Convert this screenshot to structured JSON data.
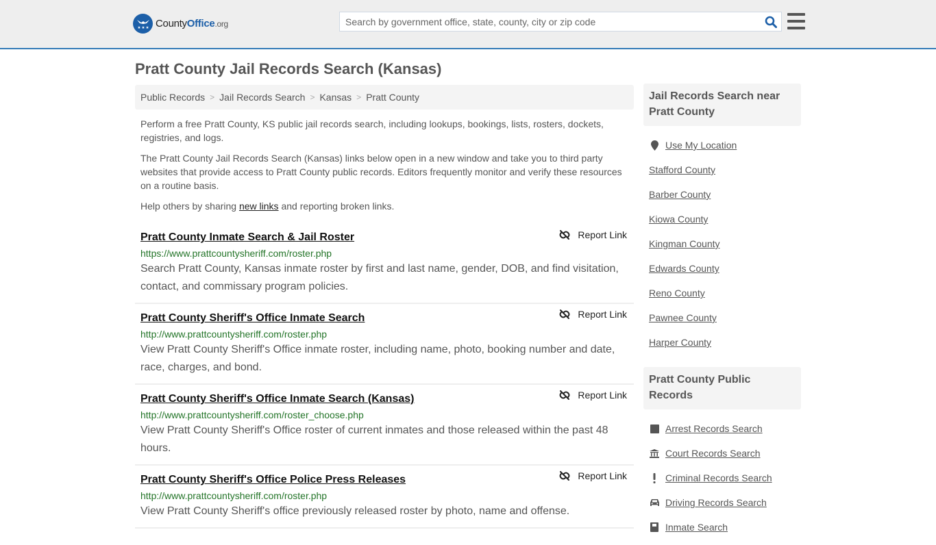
{
  "header": {
    "logo": {
      "county": "County",
      "office": "Office",
      "org": ".org"
    },
    "search_placeholder": "Search by government office, state, county, city or zip code",
    "search_value": "",
    "search_icon": "magnifier-icon",
    "menu_icon": "hamburger-icon"
  },
  "colors": {
    "header_bg": "#eeeeee",
    "header_border": "#337ab7",
    "brand_blue": "#1c5fa8",
    "url_green": "#237428",
    "text": "#555555"
  },
  "page_title": "Pratt County Jail Records Search (Kansas)",
  "breadcrumb": [
    {
      "label": "Public Records"
    },
    {
      "label": "Jail Records Search"
    },
    {
      "label": "Kansas"
    },
    {
      "label": "Pratt County"
    }
  ],
  "breadcrumb_separator": ">",
  "intro": {
    "p1": "Perform a free Pratt County, KS public jail records search, including lookups, bookings, lists, rosters, dockets, registries, and logs.",
    "p2": "The Pratt County Jail Records Search (Kansas) links below open in a new window and take you to third party websites that provide access to Pratt County public records. Editors frequently monitor and verify these resources on a routine basis.",
    "p3_before": "Help others by sharing ",
    "p3_link": "new links",
    "p3_after": " and reporting broken links."
  },
  "results": [
    {
      "title": "Pratt County Inmate Search & Jail Roster",
      "url": "https://www.prattcountysheriff.com/roster.php",
      "description": "Search Pratt County, Kansas inmate roster by first and last name, gender, DOB, and find visitation, contact, and commissary program policies.",
      "report_label": "Report Link"
    },
    {
      "title": "Pratt County Sheriff's Office Inmate Search",
      "url": "http://www.prattcountysheriff.com/roster.php",
      "description": "View Pratt County Sheriff's Office inmate roster, including name, photo, booking number and date, race, charges, and bond.",
      "report_label": "Report Link"
    },
    {
      "title": "Pratt County Sheriff's Office Inmate Search (Kansas)",
      "url": "http://www.prattcountysheriff.com/roster_choose.php",
      "description": "View Pratt County Sheriff's Office roster of current inmates and those released within the past 48 hours.",
      "report_label": "Report Link"
    },
    {
      "title": "Pratt County Sheriff's Office Police Press Releases",
      "url": "http://www.prattcountysheriff.com/roster.php",
      "description": "View Pratt County Sheriff's office previously released roster by photo, name and offense.",
      "report_label": "Report Link"
    }
  ],
  "sidebar": {
    "nearby": {
      "heading": "Jail Records Search near Pratt County",
      "use_location": {
        "label": "Use My Location",
        "icon": "map-marker-icon"
      },
      "items": [
        {
          "label": "Stafford County"
        },
        {
          "label": "Barber County"
        },
        {
          "label": "Kiowa County"
        },
        {
          "label": "Kingman County"
        },
        {
          "label": "Edwards County"
        },
        {
          "label": "Reno County"
        },
        {
          "label": "Pawnee County"
        },
        {
          "label": "Harper County"
        }
      ]
    },
    "public_records": {
      "heading": "Pratt County Public Records",
      "items": [
        {
          "label": "Arrest Records Search",
          "icon": "square-icon"
        },
        {
          "label": "Court Records Search",
          "icon": "courthouse-icon"
        },
        {
          "label": "Criminal Records Search",
          "icon": "exclamation-icon"
        },
        {
          "label": "Driving Records Search",
          "icon": "car-icon"
        },
        {
          "label": "Inmate Search",
          "icon": "inmate-icon"
        }
      ]
    }
  }
}
